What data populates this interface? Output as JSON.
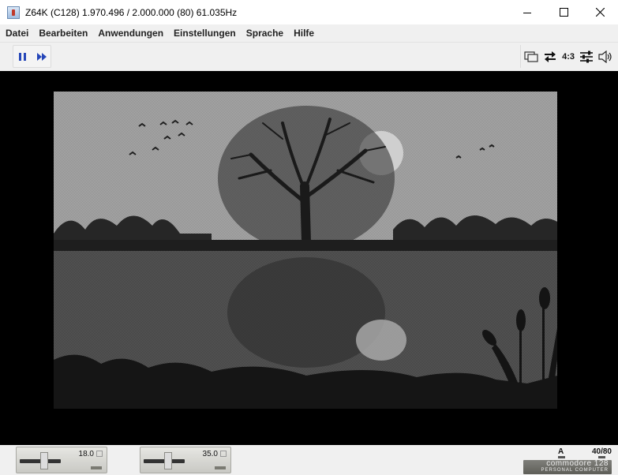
{
  "window": {
    "title": "Z64K (C128) 1.970.496 / 2.000.000 (80)  61.035Hz"
  },
  "menu": [
    {
      "label": "Datei"
    },
    {
      "label": "Bearbeiten"
    },
    {
      "label": "Anwendungen"
    },
    {
      "label": "Einstellungen"
    },
    {
      "label": "Sprache"
    },
    {
      "label": "Hilfe"
    }
  ],
  "toolbar": {
    "left": [
      {
        "icon": "pause-icon"
      },
      {
        "icon": "fast-forward-icon"
      }
    ],
    "right": {
      "monitor_icon": "monitor-icon",
      "swap_icon": "swap-icon",
      "aspect_ratio": "4:3",
      "settings_icon": "sliders-icon",
      "sound_icon": "speaker-icon"
    }
  },
  "screen": {
    "description_icon": "emulator-display",
    "colors": {
      "border": "#000000",
      "sky": "#9a9a9a",
      "water": "#4a4a4a",
      "moon": "#c8c8c8",
      "ground": "#1a1a1a"
    }
  },
  "status": {
    "drive1": {
      "value": "18.0"
    },
    "drive2": {
      "value": "35.0"
    },
    "drive_letter": "A",
    "columns": "40/80",
    "badge_main": "commodore 128",
    "badge_sub": "PERSONAL COMPUTER"
  }
}
